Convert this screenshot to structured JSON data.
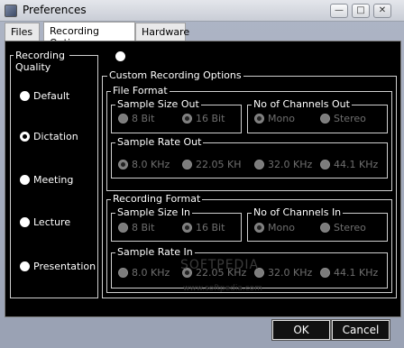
{
  "window": {
    "title": "Preferences"
  },
  "tabs": [
    "Files",
    "Recording Options",
    "Hardware"
  ],
  "quality": {
    "legend": "Recording Quality",
    "options": [
      "Default",
      "Dictation",
      "Meeting",
      "Lecture",
      "Presentation"
    ],
    "selected": "Dictation"
  },
  "custom": {
    "legend": "Custom Recording Options"
  },
  "file_format": {
    "legend": "File Format",
    "sample_size": {
      "legend": "Sample Size Out",
      "options": [
        "8 Bit",
        "16 Bit"
      ],
      "selected": "16 Bit"
    },
    "channels": {
      "legend": "No of Channels Out",
      "options": [
        "Mono",
        "Stereo"
      ],
      "selected": "Mono"
    },
    "sample_rate": {
      "legend": "Sample Rate Out",
      "options": [
        "8.0 KHz",
        "22.05 KH",
        "32.0 KHz",
        "44.1 KHz"
      ],
      "selected": "8.0 KHz"
    }
  },
  "recording_format": {
    "legend": "Recording Format",
    "sample_size": {
      "legend": "Sample Size In",
      "options": [
        "8 Bit",
        "16 Bit"
      ],
      "selected": "16 Bit"
    },
    "channels": {
      "legend": "No of Channels In",
      "options": [
        "Mono",
        "Stereo"
      ],
      "selected": "Mono"
    },
    "sample_rate": {
      "legend": "Sample Rate In",
      "options": [
        "8.0 KHz",
        "22.05 KHz",
        "32.0 KHz",
        "44.1 KHz"
      ],
      "selected": "22.05 KHz"
    }
  },
  "buttons": {
    "ok": "OK",
    "cancel": "Cancel"
  },
  "watermark": {
    "text": "SOFTPEDIA",
    "url": "www.softpedia.com"
  },
  "icons": {
    "app": "app-icon",
    "minimize": "minimize-icon",
    "maximize": "maximize-icon",
    "close": "close-icon"
  }
}
